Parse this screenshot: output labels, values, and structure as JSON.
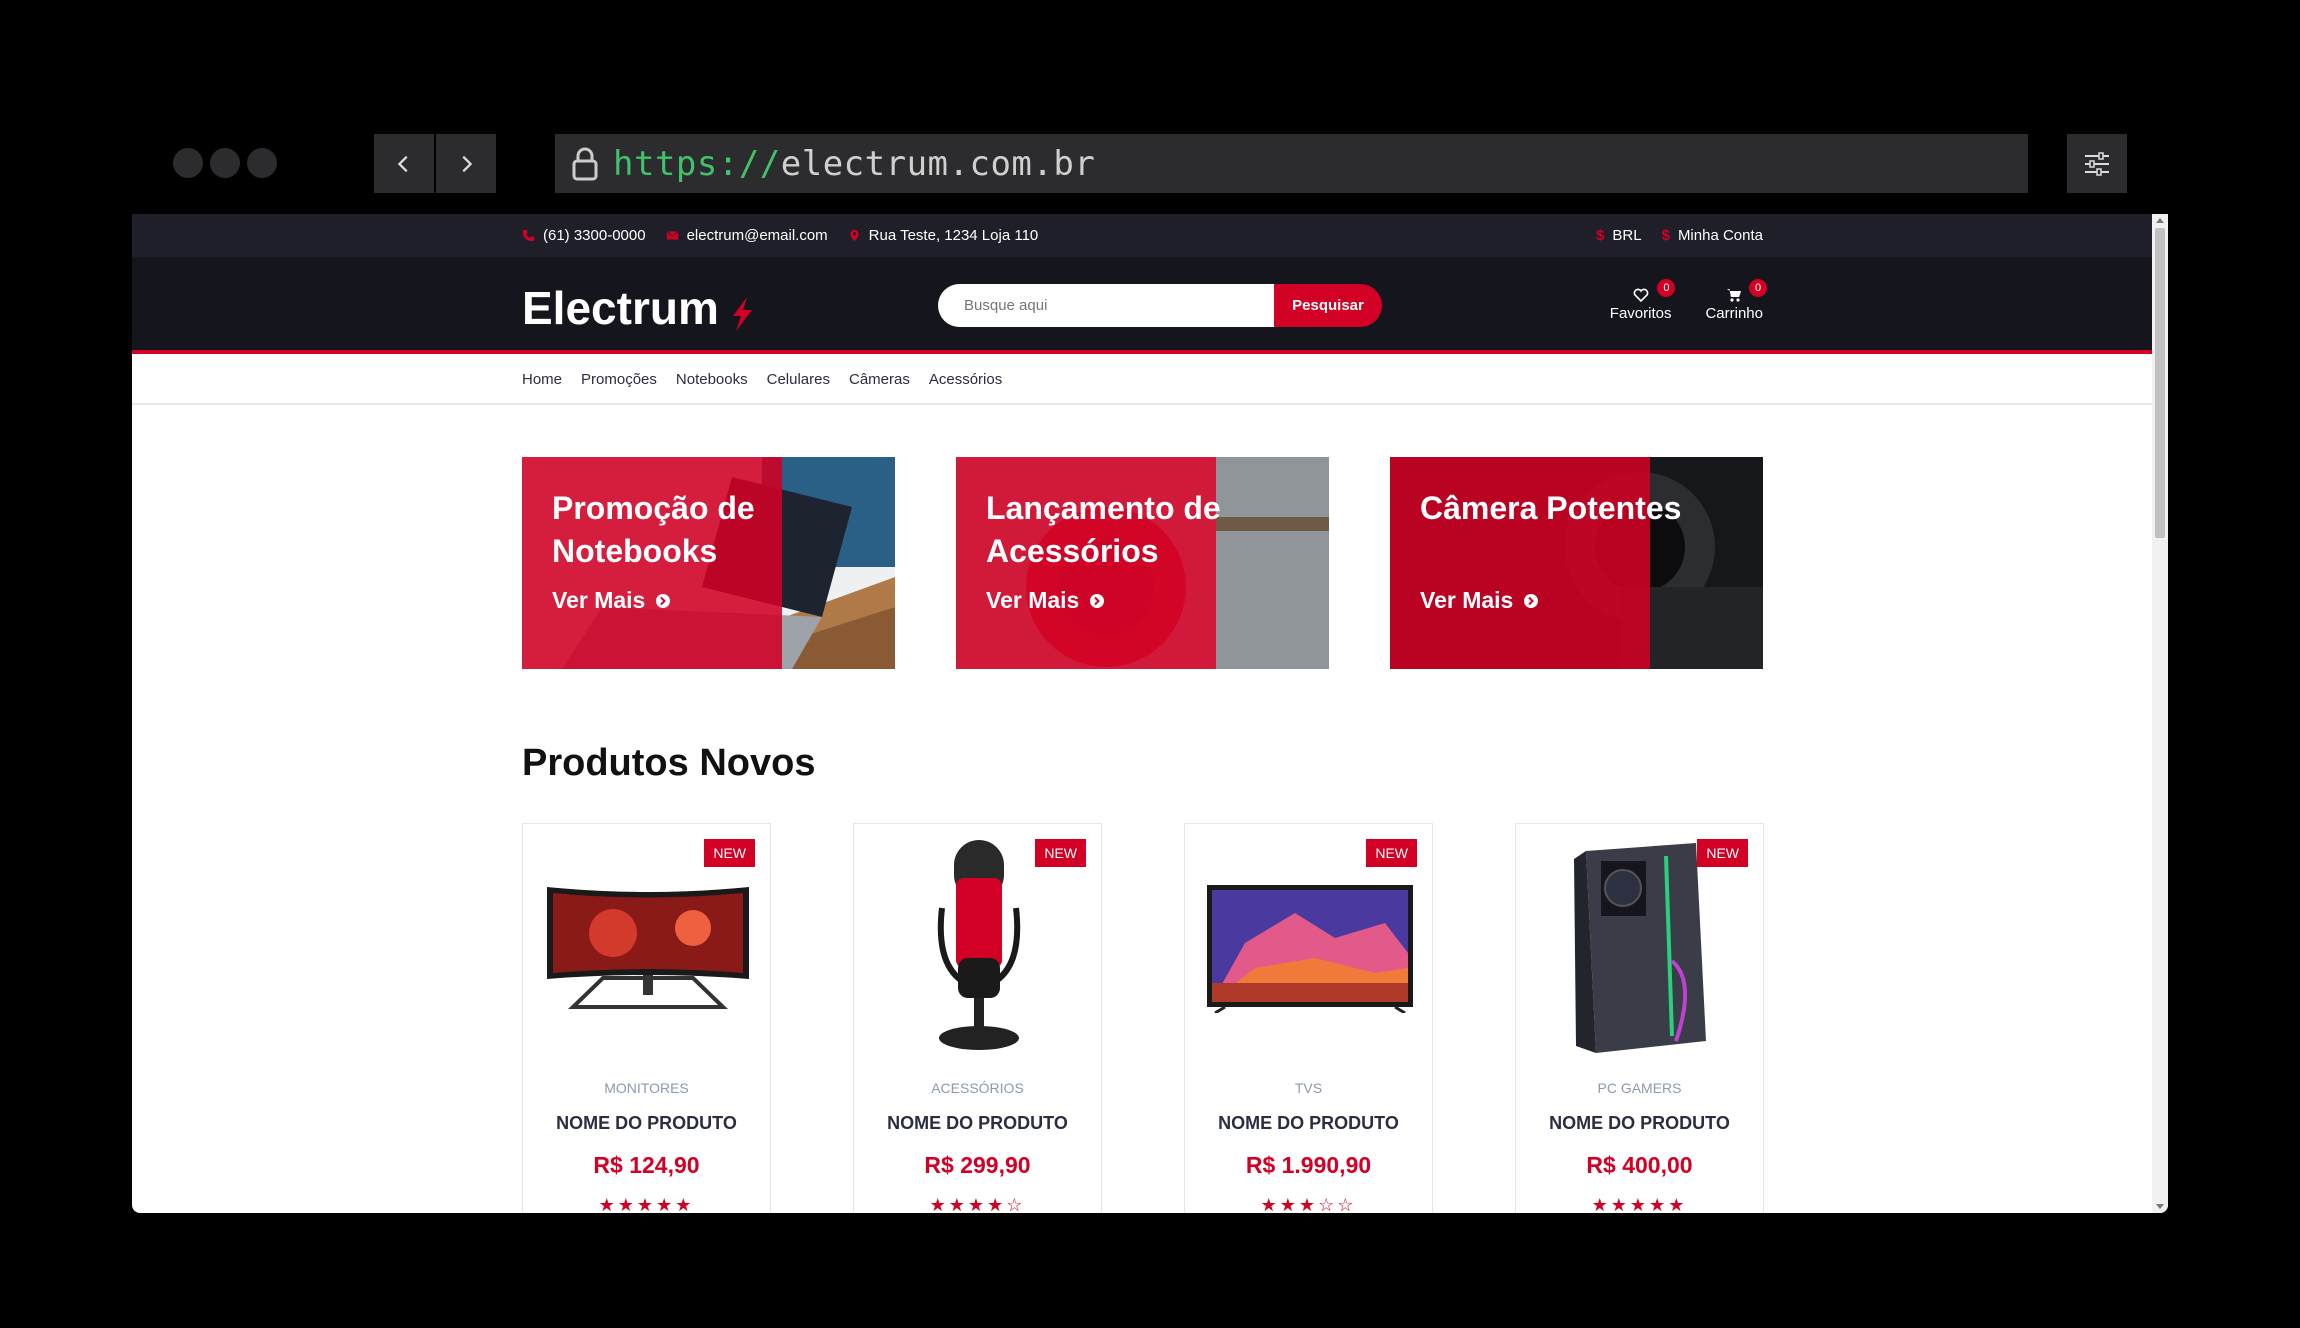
{
  "browser": {
    "url_proto": "https://",
    "url_host": "electrum.com.br"
  },
  "topbar": {
    "phone": "(61) 3300-0000",
    "email": "electrum@email.com",
    "address": "Rua Teste, 1234 Loja 110",
    "currency": "BRL",
    "account": "Minha Conta"
  },
  "header": {
    "logo": "Electrum",
    "search_placeholder": "Busque aqui",
    "search_button": "Pesquisar",
    "favorites_label": "Favoritos",
    "favorites_count": "0",
    "cart_label": "Carrinho",
    "cart_count": "0"
  },
  "nav": {
    "items": [
      "Home",
      "Promoções",
      "Notebooks",
      "Celulares",
      "Câmeras",
      "Acessórios"
    ]
  },
  "banners": [
    {
      "title": "Promoção de Notebooks",
      "cta": "Ver Mais"
    },
    {
      "title": "Lançamento de Acessórios",
      "cta": "Ver Mais"
    },
    {
      "title": "Câmera Potentes",
      "cta": "Ver Mais"
    }
  ],
  "section_title": "Produtos Novos",
  "products": [
    {
      "tag": "NEW",
      "category": "MONITORES",
      "name": "NOME DO PRODUTO",
      "price": "R$ 124,90",
      "rating": 5,
      "stars": "★★★★★"
    },
    {
      "tag": "NEW",
      "category": "ACESSÓRIOS",
      "name": "NOME DO PRODUTO",
      "price": "R$ 299,90",
      "rating": 4,
      "stars": "★★★★☆"
    },
    {
      "tag": "NEW",
      "category": "TVS",
      "name": "NOME DO PRODUTO",
      "price": "R$ 1.990,90",
      "rating": 3,
      "stars": "★★★☆☆"
    },
    {
      "tag": "NEW",
      "category": "PC GAMERS",
      "name": "NOME DO PRODUTO",
      "price": "R$ 400,00",
      "rating": 5,
      "stars": "★★★★★"
    }
  ],
  "colors": {
    "accent": "#d10024",
    "header_bg": "#15161d",
    "topbar_bg": "#1e1f29"
  }
}
